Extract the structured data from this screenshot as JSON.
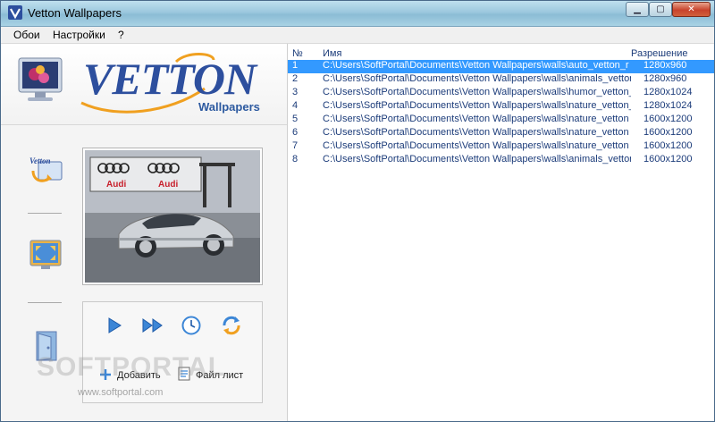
{
  "window": {
    "title": "Vetton Wallpapers",
    "controls": {
      "minimize": "▁",
      "maximize": "▢",
      "close": "✕"
    }
  },
  "menu": {
    "items": [
      "Обои",
      "Настройки",
      "?"
    ]
  },
  "logo": {
    "brand": "VETTON",
    "sub": "Wallpapers",
    "brand_color": "#2d4f9e",
    "swoosh_color": "#f0a020"
  },
  "sidebar": {
    "icons": [
      "vetton-wallpaper-icon",
      "stretch-screen-icon",
      "desktop-door-icon"
    ]
  },
  "preview": {
    "banner_text": "Audi"
  },
  "controls": {
    "icons": [
      "play-icon",
      "fast-forward-icon",
      "clock-icon",
      "refresh-icon"
    ],
    "add_label": "Добавить",
    "filelist_label": "Файл лист"
  },
  "watermark": {
    "text": "SOFTPORTAL",
    "sub": "www.softportal.com"
  },
  "list": {
    "headers": {
      "num": "№",
      "name": "Имя",
      "res": "Разрешение"
    },
    "selected_index": 0,
    "selection_color": "#3399ff",
    "text_color": "#1c3c7a",
    "rows": [
      {
        "num": "1",
        "name": "C:\\Users\\SoftPortal\\Documents\\Vetton Wallpapers\\walls\\auto_vetton_r",
        "res": "1280x960"
      },
      {
        "num": "2",
        "name": "C:\\Users\\SoftPortal\\Documents\\Vetton Wallpapers\\walls\\animals_vettor",
        "res": "1280x960"
      },
      {
        "num": "3",
        "name": "C:\\Users\\SoftPortal\\Documents\\Vetton Wallpapers\\walls\\humor_vetton_",
        "res": "1280x1024"
      },
      {
        "num": "4",
        "name": "C:\\Users\\SoftPortal\\Documents\\Vetton Wallpapers\\walls\\nature_vetton_",
        "res": "1280x1024"
      },
      {
        "num": "5",
        "name": "C:\\Users\\SoftPortal\\Documents\\Vetton Wallpapers\\walls\\nature_vetton",
        "res": "1600x1200"
      },
      {
        "num": "6",
        "name": "C:\\Users\\SoftPortal\\Documents\\Vetton Wallpapers\\walls\\nature_vetton",
        "res": "1600x1200"
      },
      {
        "num": "7",
        "name": "C:\\Users\\SoftPortal\\Documents\\Vetton Wallpapers\\walls\\nature_vetton",
        "res": "1600x1200"
      },
      {
        "num": "8",
        "name": "C:\\Users\\SoftPortal\\Documents\\Vetton Wallpapers\\walls\\animals_vettor",
        "res": "1600x1200"
      }
    ]
  }
}
